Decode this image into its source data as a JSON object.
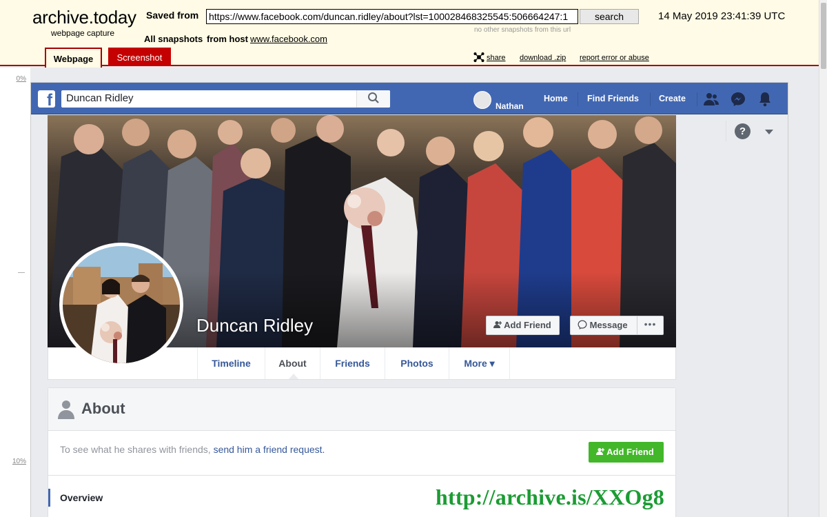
{
  "archive": {
    "logo_title": "archive.today",
    "logo_sub": "webpage capture",
    "saved_label": "Saved from",
    "url": "https://www.facebook.com/duncan.ridley/about?lst=100028468325545:506664247:1",
    "search_label": "search",
    "no_other": "no other snapshots from this url",
    "timestamp": "14 May 2019 23:41:39 UTC",
    "all_snapshots": "All snapshots",
    "from_host": "from host",
    "host": "www.facebook.com",
    "tabs": {
      "webpage": "Webpage",
      "screenshot": "Screenshot"
    },
    "share": "share",
    "download": "download .zip",
    "report": "report error or abuse",
    "gutter": {
      "top": "0%",
      "mid": "—",
      "bottom": "10%"
    },
    "watermark": "http://archive.is/XXOg8"
  },
  "facebook": {
    "search_value": "Duncan Ridley",
    "user_name": "Nathan",
    "nav": {
      "home": "Home",
      "find_friends": "Find Friends",
      "create": "Create"
    },
    "profile_name": "Duncan Ridley",
    "buttons": {
      "add_friend": "Add Friend",
      "message": "Message",
      "more": "•••"
    },
    "tabs": [
      "Timeline",
      "About",
      "Friends",
      "Photos",
      "More ▾"
    ],
    "about": {
      "title": "About",
      "msg_prefix": "To see what he shares with friends,",
      "msg_link": "send him a friend request.",
      "add_friend": "Add Friend",
      "overview": "Overview"
    },
    "help": "?"
  },
  "colors": {
    "fb_blue": "#4267b2",
    "archive_red": "#a40000",
    "archive_bg": "#fffbe6",
    "fb_green": "#42b72a",
    "watermark": "#1b9c33"
  }
}
